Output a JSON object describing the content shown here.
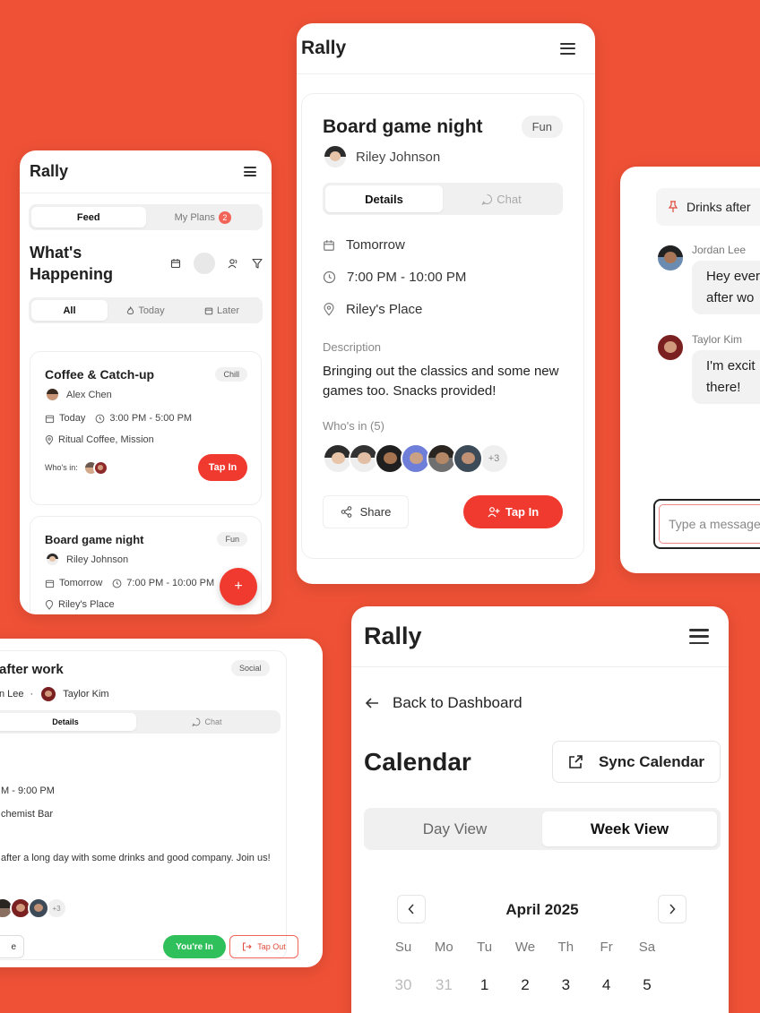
{
  "brand": "Rally",
  "feed": {
    "tabs": [
      "Feed",
      "My Plans"
    ],
    "plans_badge": "2",
    "heading": "What's Happening",
    "filters": [
      "All",
      "Today",
      "Later"
    ],
    "events": [
      {
        "title": "Coffee & Catch-up",
        "tag": "Chill",
        "host": "Alex Chen",
        "day": "Today",
        "time": "3:00 PM - 5:00 PM",
        "place": "Ritual Coffee, Mission",
        "whos_in_label": "Who's in:",
        "cta": "Tap In"
      },
      {
        "title": "Board game night",
        "tag": "Fun",
        "host": "Riley Johnson",
        "day": "Tomorrow",
        "time": "7:00 PM - 10:00 PM",
        "place": "Riley's Place"
      }
    ],
    "fab": "+"
  },
  "detail": {
    "title": "Board game night",
    "tag": "Fun",
    "host": "Riley Johnson",
    "tabs": [
      "Details",
      "Chat"
    ],
    "day": "Tomorrow",
    "time": "7:00 PM - 10:00 PM",
    "place": "Riley's Place",
    "description_label": "Description",
    "description": "Bringing out the classics and some new games too. Snacks provided!",
    "whos_in_label": "Who's in (5)",
    "more_count": "+3",
    "share": "Share",
    "cta": "Tap In"
  },
  "chat": {
    "pinned": "Drinks after",
    "messages": [
      {
        "sender": "Jordan Lee",
        "lines": [
          "Hey ever",
          "after wo"
        ]
      },
      {
        "sender": "Taylor Kim",
        "lines": [
          "I'm excit",
          "there!"
        ]
      }
    ],
    "input_placeholder": "Type a message"
  },
  "social": {
    "title": "after work",
    "tag": "Social",
    "host_a": "n Lee",
    "sep": "·",
    "host_b": "Taylor Kim",
    "tabs": [
      "Details",
      "Chat"
    ],
    "time": "M - 9:00 PM",
    "place": "chemist Bar",
    "description": "after a long day with some drinks and good company. Join us!",
    "more_count": "+3",
    "left_btn": "e",
    "youre_in": "You're In",
    "tap_out": "Tap Out"
  },
  "calendar": {
    "back": "Back to Dashboard",
    "title": "Calendar",
    "sync": "Sync Calendar",
    "views": [
      "Day View",
      "Week View"
    ],
    "month": "April 2025",
    "weekdays": [
      "Su",
      "Mo",
      "Tu",
      "We",
      "Th",
      "Fr",
      "Sa"
    ],
    "days": [
      "30",
      "31",
      "1",
      "2",
      "3",
      "4",
      "5"
    ]
  },
  "colors": {
    "accent": "#f0392f",
    "background": "#ef5136",
    "success": "#2fbf5b"
  }
}
